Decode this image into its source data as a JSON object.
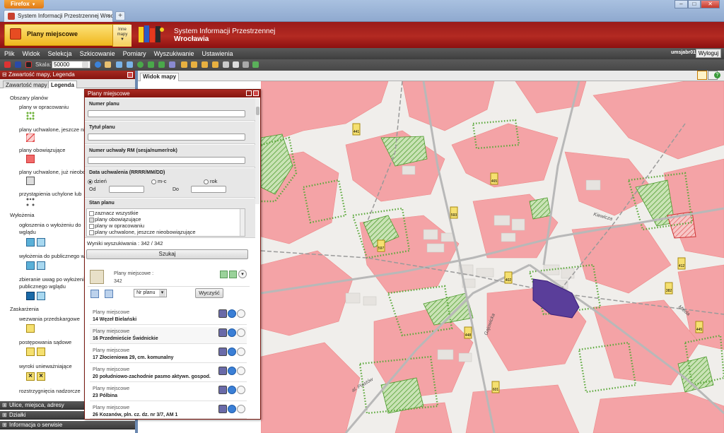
{
  "browser": {
    "app_button": "Firefox",
    "tab_title": "System Informacji Przestrzennej Wrocła...",
    "new_tab": "+",
    "close": "×"
  },
  "header": {
    "module": "Plany miejscowe",
    "other_maps": "Inne mapy",
    "title_line1": "System Informacji Przestrzennej",
    "title_line2": "Wrocławia"
  },
  "menu": {
    "items": [
      "Plik",
      "Widok",
      "Selekcja",
      "Szkicowanie",
      "Pomiary",
      "Wyszukiwanie",
      "Ustawienia"
    ],
    "user": "umsjabr01",
    "logout": "Wyloguj"
  },
  "toolbar": {
    "scale_label": "Skala:",
    "scale_value": "50000"
  },
  "left_panel": {
    "title": "Zawartość mapy, Legenda",
    "tabs": [
      "Zawartość mapy",
      "Legenda"
    ],
    "legend": {
      "g1": "Obszary planów",
      "i1": "plany w opracowaniu",
      "i2": "plany uchwalone, jeszcze ni",
      "i3": "plany obowiązujące",
      "i4": "plany uchwalone, już nieobo",
      "i5": "przystąpienia uchylone lub",
      "g2": "Wyłożenia",
      "i6a": "ogłoszenia o wyłożeniu do",
      "i6b": "wglądu",
      "i7": "wyłożenia do publicznego w",
      "i8a": "zbieranie uwag po wyłożeni",
      "i8b": "publicznego wglądu",
      "g3": "Zaskarżenia",
      "i9": "wezwania przedskargowe",
      "i10": "postępowania sądowe",
      "i11": "wyroki unieważniające",
      "i12": "rozstrzygnięcia nadzorcze"
    },
    "bottom": [
      "Ulice, miejsca, adresy",
      "Działki",
      "Informacja o serwisie"
    ]
  },
  "map": {
    "tab": "Widok mapy",
    "help": "?"
  },
  "dialog": {
    "title": "Plany miejscowe",
    "numer_planu": "Numer planu",
    "tytul_planu": "Tytuł planu",
    "numer_uchwaly": "Numer uchwały RM (sesja/numer/rok)",
    "data_uchwalenia": "Data uchwalenia (RRRR/MM/DD)",
    "radio_dzien": "dzień",
    "radio_mc": "m-c",
    "radio_rok": "rok",
    "od": "Od",
    "do": "Do",
    "stan_planu": "Stan planu",
    "stan_items": [
      "zaznacz wszystkie",
      "plany obowiązujące",
      "plany w opracowaniu",
      "plany uchwalone, jeszcze nieobowiązujące"
    ],
    "wyniki": "Wyniki wyszukiwania : 342 / 342",
    "szukaj": "Szukaj",
    "layer_label": "Plany miejscowe :",
    "layer_count": "342",
    "sort_value": "Nr planu",
    "wyczysc": "Wyczyść",
    "results": [
      {
        "type": "Plany miejscowe",
        "name": "14 Węzeł Bielański"
      },
      {
        "type": "Plany miejscowe",
        "name": "16 Przedmieście Świdnickie"
      },
      {
        "type": "Plany miejscowe",
        "name": "17 Złocieniowa 29, cm. komunalny"
      },
      {
        "type": "Plany miejscowe",
        "name": "20 południowo-zachodnie pasmo aktywn. gospod."
      },
      {
        "type": "Plany miejscowe",
        "name": "23 Pólbina"
      },
      {
        "type": "Plany miejscowe",
        "name": "26 Kozanów, pln. cz. dz. nr 3/7, AM 1"
      }
    ]
  },
  "map_labels": {
    "m1": "441",
    "m2": "465",
    "m3": "593",
    "m4": "597",
    "m5": "402",
    "m6": "448",
    "m7": "382",
    "m8": "412",
    "m9": "601",
    "m10": "445"
  },
  "street_labels": [
    "Gajowicka",
    "al. Piastów",
    "Kiewicza",
    "Mieda"
  ],
  "colors": {
    "plan_binding": "#f4a3a6",
    "plan_working": "#6fb33a",
    "selected": "#5a3e9a",
    "brand": "#a62a22"
  }
}
